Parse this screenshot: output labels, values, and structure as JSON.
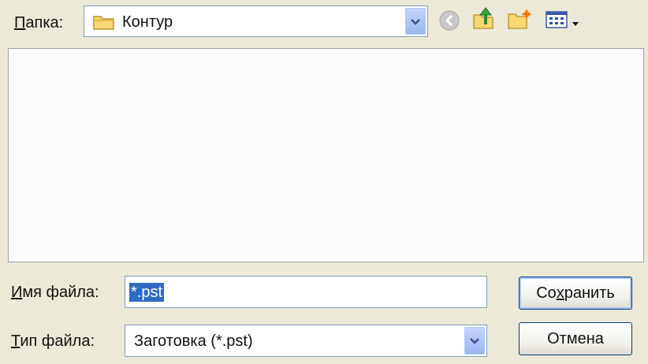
{
  "folder": {
    "label": "Папка:",
    "label_underlined_char": "П",
    "label_rest": "апка:",
    "current": "Контур",
    "icon": "folder-icon"
  },
  "toolbar": {
    "back_icon": "back-arrow-icon",
    "up_icon": "up-folder-icon",
    "new_folder_icon": "new-folder-icon",
    "view_menu_icon": "view-menu-icon"
  },
  "filename": {
    "label_underlined_char": "И",
    "label_rest": "мя файла:",
    "value": "*.pst"
  },
  "filetype": {
    "label_underlined_char": "Т",
    "label_rest": "ип файла:",
    "value": "Заготовка (*.pst)"
  },
  "buttons": {
    "save_pre": "Со",
    "save_ul": "х",
    "save_post": "ранить",
    "cancel": "Отмена"
  }
}
